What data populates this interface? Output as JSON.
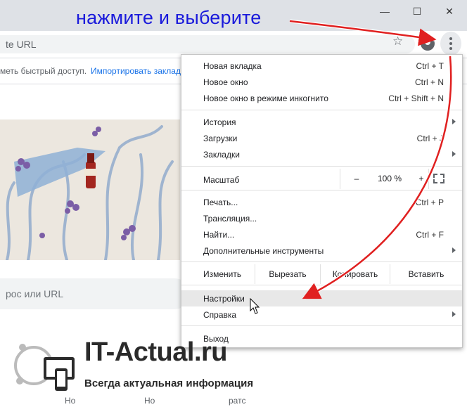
{
  "annotation": {
    "text": "нажмите и выберите"
  },
  "window": {
    "minimize": "—",
    "maximize": "☐",
    "close": "✕"
  },
  "omnibox": {
    "text": "te URL"
  },
  "bookmarks": {
    "text": "меть быстрый доступ.",
    "link": "Импортировать заклад"
  },
  "search": {
    "placeholder": "рос или URL"
  },
  "menu": {
    "items_top": [
      {
        "label": "Новая вкладка",
        "shortcut": "Ctrl + T"
      },
      {
        "label": "Новое окно",
        "shortcut": "Ctrl + N"
      },
      {
        "label": "Новое окно в режиме инкогнито",
        "shortcut": "Ctrl + Shift + N"
      }
    ],
    "items_history": [
      {
        "label": "История",
        "shortcut": ""
      },
      {
        "label": "Загрузки",
        "shortcut": "Ctrl + J"
      },
      {
        "label": "Закладки",
        "shortcut": ""
      }
    ],
    "zoom": {
      "label": "Масштаб",
      "minus": "–",
      "value": "100 %",
      "plus": "+"
    },
    "items_tools": [
      {
        "label": "Печать...",
        "shortcut": "Ctrl + P"
      },
      {
        "label": "Трансляция...",
        "shortcut": ""
      },
      {
        "label": "Найти...",
        "shortcut": "Ctrl + F"
      },
      {
        "label": "Дополнительные инструменты",
        "shortcut": ""
      }
    ],
    "edit": {
      "label": "Изменить",
      "cut": "Вырезать",
      "copy": "Копировать",
      "paste": "Вставить"
    },
    "settings": "Настройки",
    "help": "Справка",
    "exit": "Выход"
  },
  "watermark": {
    "title": "IT-Actual.ru",
    "subtitle": "Всегда актуальная информация"
  },
  "bottom_links": [
    "Но",
    "Но",
    "ратс"
  ],
  "colors": {
    "annotation": "#1a1adb",
    "arrow": "#e02020",
    "link": "#1a73e8"
  },
  "icons": [
    "minimize-icon",
    "maximize-icon",
    "close-icon",
    "star-icon",
    "profile-icon",
    "kebab-menu-icon",
    "submenu-arrow-icon",
    "fullscreen-icon",
    "cursor-icon"
  ]
}
